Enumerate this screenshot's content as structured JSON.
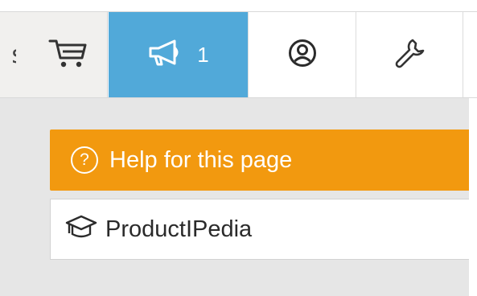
{
  "toolbar": {
    "cart_edge_text": "s",
    "notifications_count": "1",
    "colors": {
      "notifications_bg": "#51a9d9",
      "cart_bg": "#f1f0ee"
    },
    "icons": [
      "shopping-cart-icon",
      "megaphone-icon",
      "user-circle-icon",
      "wrench-icon"
    ]
  },
  "help": {
    "label": "Help for this page",
    "icon_glyph": "?",
    "color": "#f2990f"
  },
  "pedia": {
    "label": "ProductIPedia",
    "icon": "graduation-cap-icon"
  }
}
